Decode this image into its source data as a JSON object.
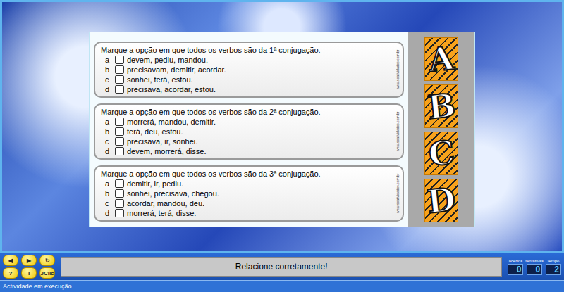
{
  "questions": [
    {
      "prompt": "Marque a opção em que todos os verbos são da 1ª conjugação.",
      "watermark": "www.soatividades.com.br",
      "options": [
        {
          "letter": "a",
          "text": "devem, pediu, mandou.",
          "checked": false
        },
        {
          "letter": "b",
          "text": "precisavam, demitir, acordar.",
          "checked": false
        },
        {
          "letter": "c",
          "text": "sonhei, terá, estou.",
          "checked": false
        },
        {
          "letter": "d",
          "text": "precisava, acordar, estou.",
          "checked": false
        }
      ]
    },
    {
      "prompt": "Marque a opção em que todos os verbos são da 2ª conjugação.",
      "watermark": "www.soatividades.com.br",
      "options": [
        {
          "letter": "a",
          "text": "morrerá, mandou, demitir.",
          "checked": false
        },
        {
          "letter": "b",
          "text": "terá, deu, estou.",
          "checked": false
        },
        {
          "letter": "c",
          "text": "precisava, ir, sonhei.",
          "checked": false
        },
        {
          "letter": "d",
          "text": "devem, morrerá, disse.",
          "checked": false
        }
      ]
    },
    {
      "prompt": "Marque a opção em que todos os verbos são da 3ª conjugação.",
      "watermark": "www.soatividades.com.br",
      "options": [
        {
          "letter": "a",
          "text": "demitir, ir, pediu.",
          "checked": false
        },
        {
          "letter": "b",
          "text": "sonhei, precisava, chegou.",
          "checked": false
        },
        {
          "letter": "c",
          "text": "acordar, mandou, deu.",
          "checked": false
        },
        {
          "letter": "d",
          "text": "morrerá, terá, disse.",
          "checked": false
        }
      ]
    }
  ],
  "tiles": [
    "A",
    "B",
    "C",
    "D"
  ],
  "toolbar": [
    "◀",
    "▶",
    "↻",
    "?",
    "i",
    "JClic"
  ],
  "message": "Relacione corretamente!",
  "counters": [
    {
      "label": "acertos",
      "value": "0"
    },
    {
      "label": "tentativas",
      "value": "0"
    },
    {
      "label": "tempo",
      "value": "2"
    }
  ],
  "status_bar": "Actividade em execução"
}
